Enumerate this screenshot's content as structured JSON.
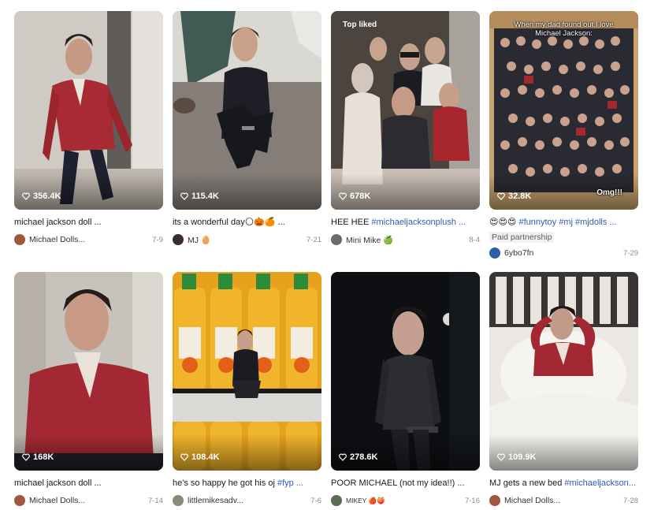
{
  "icons": {
    "views": "play-heart-icon"
  },
  "videos": [
    {
      "views": "356.4K",
      "caption": "michael jackson doll ...",
      "author": "Michael Dolls...",
      "date": "7-9"
    },
    {
      "views": "115.4K",
      "caption": "its a wonderful day🌕🎃🍊 ...",
      "author": "MJ 🥚",
      "date": "7-21"
    },
    {
      "views": "678K",
      "badge": "Top liked",
      "caption_text": "HEE HEE ",
      "caption_tags": "#michaeljacksonplush ...",
      "author": "Mini Mike 🍏",
      "date": "8-4"
    },
    {
      "views": "32.8K",
      "overlay_top": "When my dad found out I love Michael Jackson:",
      "overlay_bottom": "Omg!!!",
      "caption_text": "😍😍😍 ",
      "caption_tags": "#funnytoy #mj #mjdolls ...",
      "sponsor": "Paid partnership",
      "author": "6ybo7fn",
      "date": "7-29"
    },
    {
      "views": "168K",
      "caption": "michael jackson doll ...",
      "author": "Michael Dolls...",
      "date": "7-14"
    },
    {
      "views": "108.4K",
      "caption_text": "he's so happy he got his oj ",
      "caption_tags": "#fyp ...",
      "author": "littlemikesadv...",
      "date": "7-6"
    },
    {
      "views": "278.6K",
      "caption": "POOR MICHAEL (not my idea!!) ...",
      "author": "MIKEY 🍎🍑",
      "date": "7-16"
    },
    {
      "views": "109.9K",
      "caption_text": "MJ gets a new bed ",
      "caption_tags": "#michaeljackson...",
      "author": "Michael Dolls...",
      "date": "7-28"
    }
  ]
}
